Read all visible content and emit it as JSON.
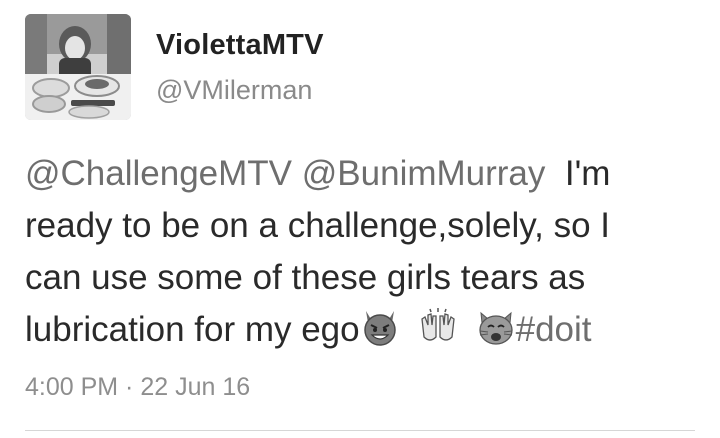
{
  "tweet": {
    "display_name": "ViolettaMTV",
    "handle": "@VMilerman",
    "text": {
      "line1": {
        "mention1": "@ChallengeMTV",
        "mention2": "@BunimMurray",
        "rest": "I'm"
      },
      "line2": "ready to be on a challenge,solely, so I",
      "line3": "can use some of these girls tears as",
      "line4": {
        "text": "lubrication for my ego",
        "hashtag": "#doit"
      }
    },
    "emojis": [
      "smiling-imp-icon",
      "raised-hands-icon",
      "weary-cat-icon"
    ],
    "timestamp": "4:00 PM · 22 Jun 16"
  },
  "colors": {
    "text": "#2a2a2a",
    "secondary": "#8a8a8a",
    "divider": "#d6d6d6"
  }
}
